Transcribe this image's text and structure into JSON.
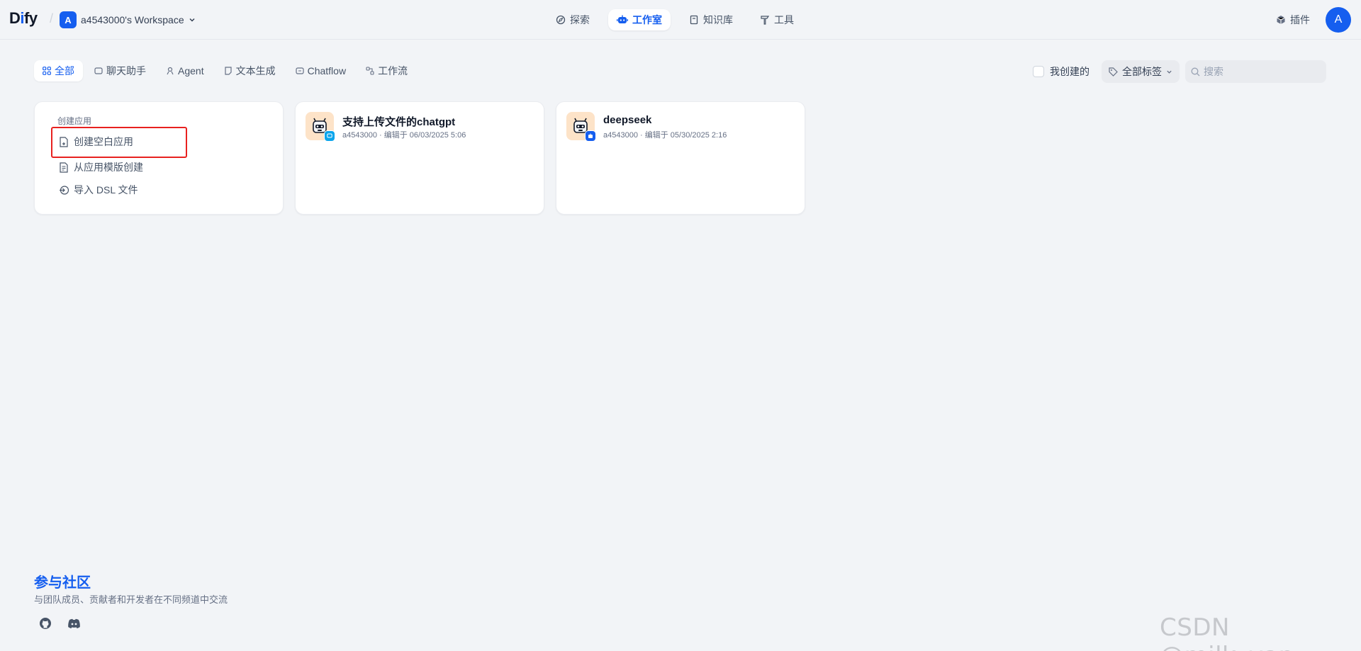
{
  "header": {
    "logo": {
      "prefix": "D",
      "accent": "i",
      "suffix": "fy"
    },
    "workspace": {
      "avatar_letter": "A",
      "name": "a4543000's Workspace"
    },
    "nav": [
      {
        "label": "探索",
        "icon": "compass-icon"
      },
      {
        "label": "工作室",
        "icon": "robot-icon",
        "active": true
      },
      {
        "label": "知识库",
        "icon": "book-icon"
      },
      {
        "label": "工具",
        "icon": "hammer-icon"
      }
    ],
    "plugin_label": "插件",
    "user_avatar_letter": "A"
  },
  "tabs": [
    {
      "label": "全部",
      "icon": "grid-icon",
      "active": true
    },
    {
      "label": "聊天助手",
      "icon": "chat-icon"
    },
    {
      "label": "Agent",
      "icon": "agent-icon"
    },
    {
      "label": "文本生成",
      "icon": "text-icon"
    },
    {
      "label": "Chatflow",
      "icon": "chatflow-icon"
    },
    {
      "label": "工作流",
      "icon": "workflow-icon"
    }
  ],
  "filters": {
    "mine_label": "我创建的",
    "mine_checked": false,
    "tags_label": "全部标签",
    "search_placeholder": "搜索"
  },
  "create_card": {
    "title": "创建应用",
    "items": [
      {
        "label": "创建空白应用",
        "icon": "file-plus-icon"
      },
      {
        "label": "从应用模版创建",
        "icon": "template-icon"
      },
      {
        "label": "导入 DSL 文件",
        "icon": "import-icon"
      }
    ]
  },
  "apps": [
    {
      "name": "支持上传文件的chatgpt",
      "author": "a4543000",
      "edited": "编辑于 06/03/2025 5:06",
      "badge_color": "#0ba5ec",
      "icon": "robot-emoji-icon"
    },
    {
      "name": "deepseek",
      "author": "a4543000",
      "edited": "编辑于 05/30/2025 2:16",
      "badge_color": "#155eef",
      "icon": "robot-emoji-icon"
    }
  ],
  "community": {
    "title": "参与社区",
    "description": "与团队成员、贡献者和开发者在不同频道中交流"
  },
  "watermark": "CSDN @milk_yan",
  "colors": {
    "accent": "#155eef",
    "highlight": "#e8211f",
    "background": "#f2f4f7"
  }
}
